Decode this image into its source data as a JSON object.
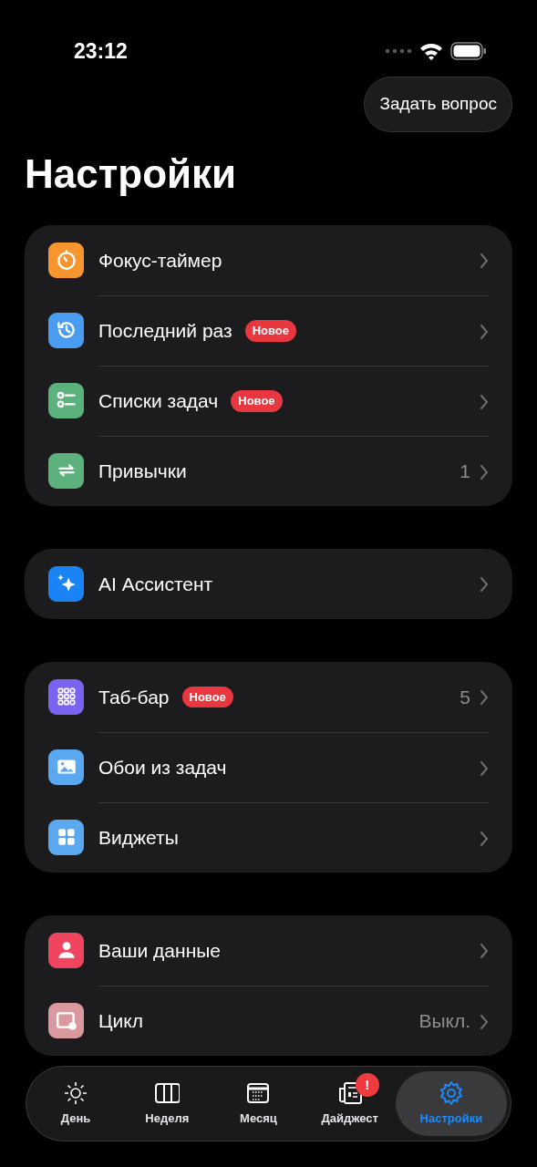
{
  "status_bar": {
    "time": "23:12"
  },
  "ask_button": "Задать вопрос",
  "title": "Настройки",
  "groups": [
    {
      "items": [
        {
          "kind": "timer",
          "color": "#f7952f",
          "label": "Фокус-таймер"
        },
        {
          "kind": "history",
          "color": "#4a9cf0",
          "label": "Последний раз",
          "badge": "Новое"
        },
        {
          "kind": "checklist",
          "color": "#5bb27c",
          "label": "Списки задач",
          "badge": "Новое"
        },
        {
          "kind": "repeat",
          "color": "#5bb27c",
          "label": "Привычки",
          "value": "1"
        }
      ]
    },
    {
      "items": [
        {
          "kind": "sparkle",
          "color": "#1a84f5",
          "label": "AI Ассистент"
        }
      ]
    },
    {
      "items": [
        {
          "kind": "grid",
          "color": "#7a63f0",
          "label": "Таб-бар",
          "badge": "Новое",
          "value": "5"
        },
        {
          "kind": "image",
          "color": "#5aa8ef",
          "label": "Обои из задач"
        },
        {
          "kind": "tiles",
          "color": "#5aa8ef",
          "label": "Виджеты"
        }
      ]
    },
    {
      "items": [
        {
          "kind": "person",
          "color": "#f0455f",
          "label": "Ваши данные"
        },
        {
          "kind": "calendar",
          "color": "#d9999e",
          "label": "Цикл",
          "value": "Выкл."
        }
      ]
    }
  ],
  "tab_bar": [
    {
      "kind": "sun",
      "label": "День",
      "selected": false
    },
    {
      "kind": "columns",
      "label": "Неделя",
      "selected": false
    },
    {
      "kind": "month",
      "label": "Месяц",
      "selected": false
    },
    {
      "kind": "news",
      "label": "Дайджест",
      "selected": false,
      "alert": "!"
    },
    {
      "kind": "gear",
      "label": "Настройки",
      "selected": true
    }
  ]
}
